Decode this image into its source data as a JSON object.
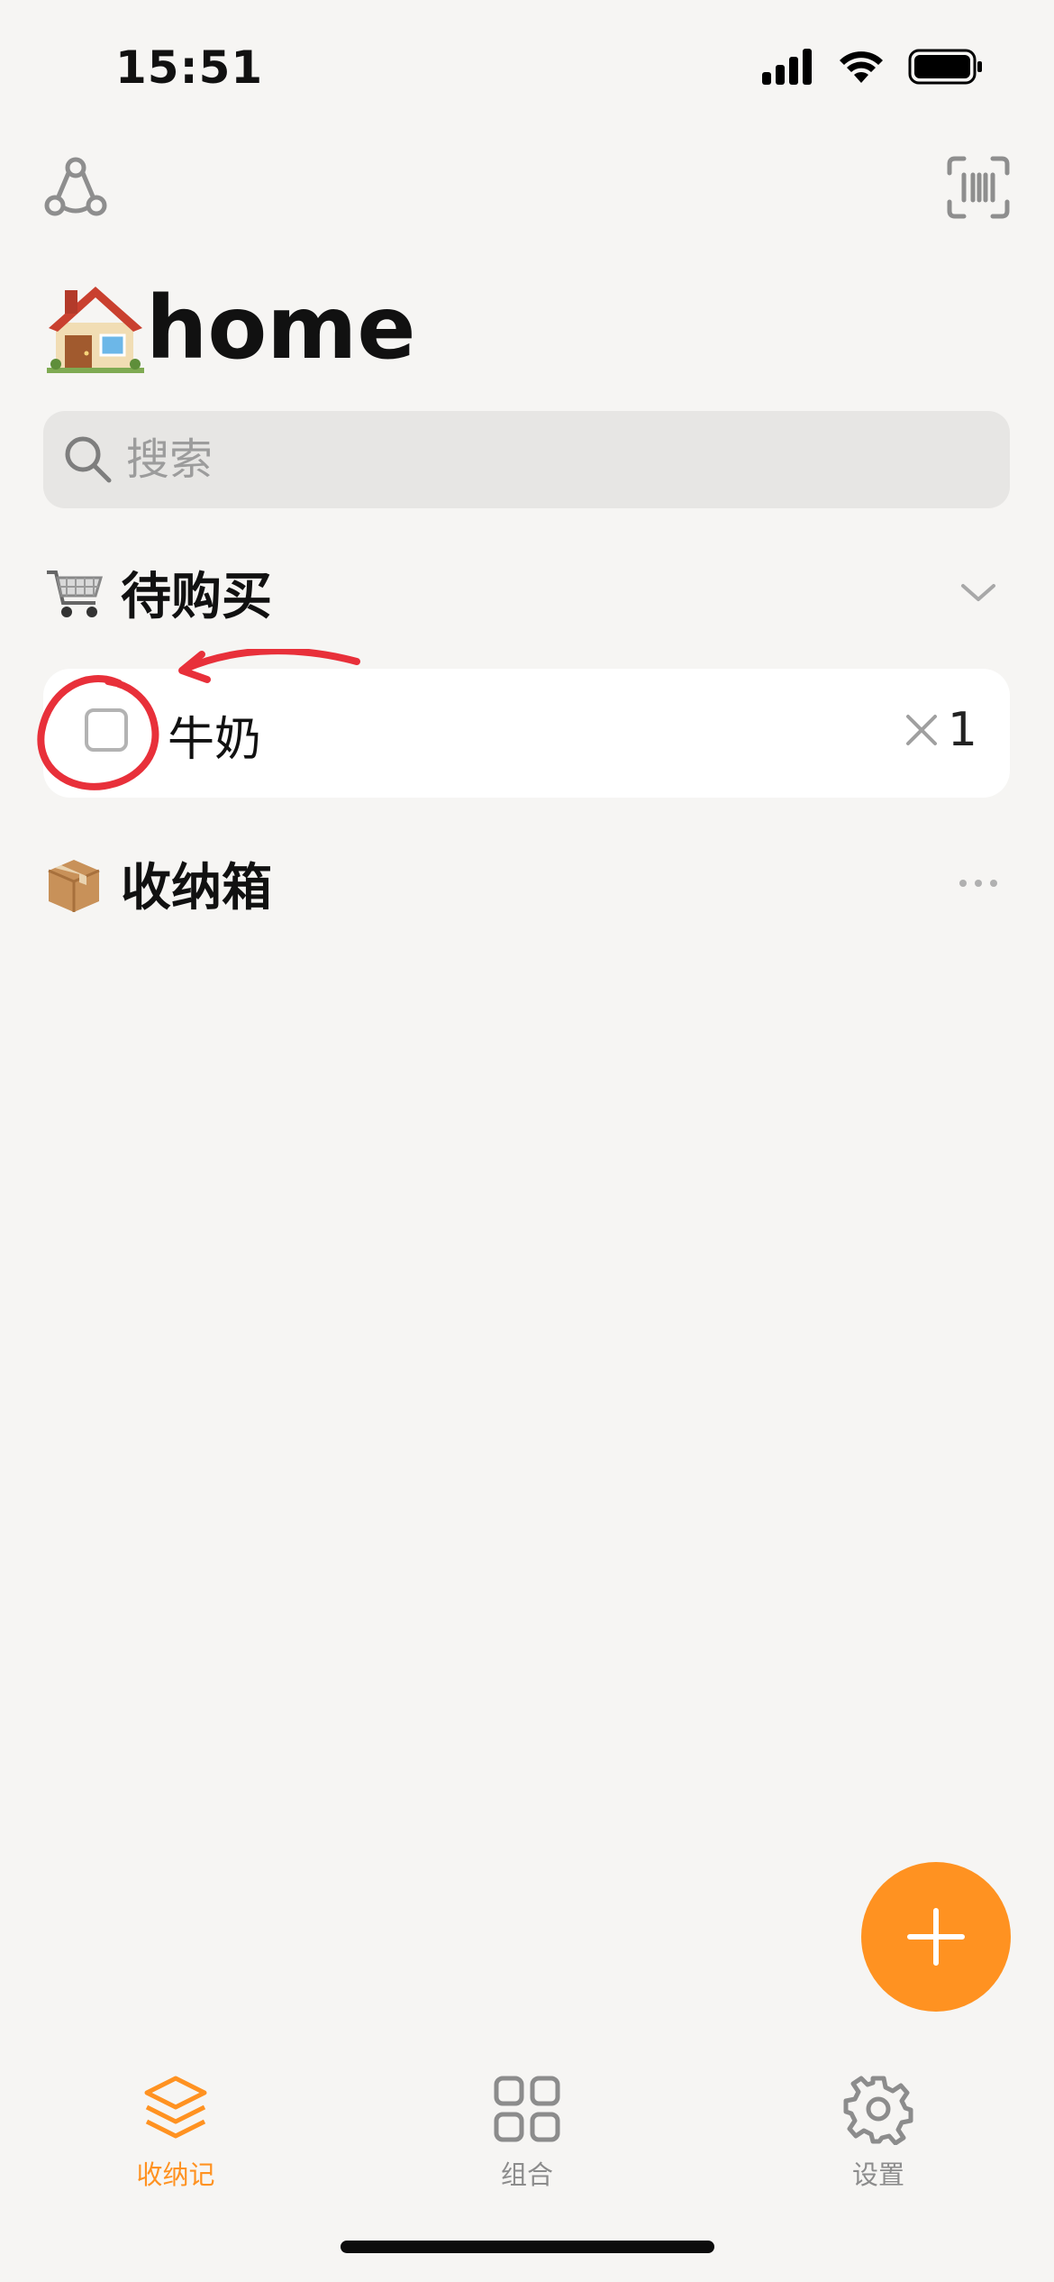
{
  "status_bar": {
    "time": "15:51"
  },
  "header": {
    "title": "home",
    "title_icon": "house-emoji"
  },
  "search": {
    "placeholder": "搜索",
    "value": ""
  },
  "sections": {
    "to_buy": {
      "icon": "shopping-cart-emoji",
      "label": "待购买",
      "items": [
        {
          "label": "牛奶",
          "quantity": "1",
          "checked": false
        }
      ]
    },
    "storage": {
      "icon": "package-emoji",
      "label": "收纳箱"
    }
  },
  "tabs": [
    {
      "label": "收纳记",
      "icon": "stack-icon",
      "active": true
    },
    {
      "label": "组合",
      "icon": "grid-icon",
      "active": false
    },
    {
      "label": "设置",
      "icon": "gear-icon",
      "active": false
    }
  ],
  "colors": {
    "accent": "#FF9221",
    "annotation": "#E8303A",
    "background": "#F6F5F3"
  }
}
